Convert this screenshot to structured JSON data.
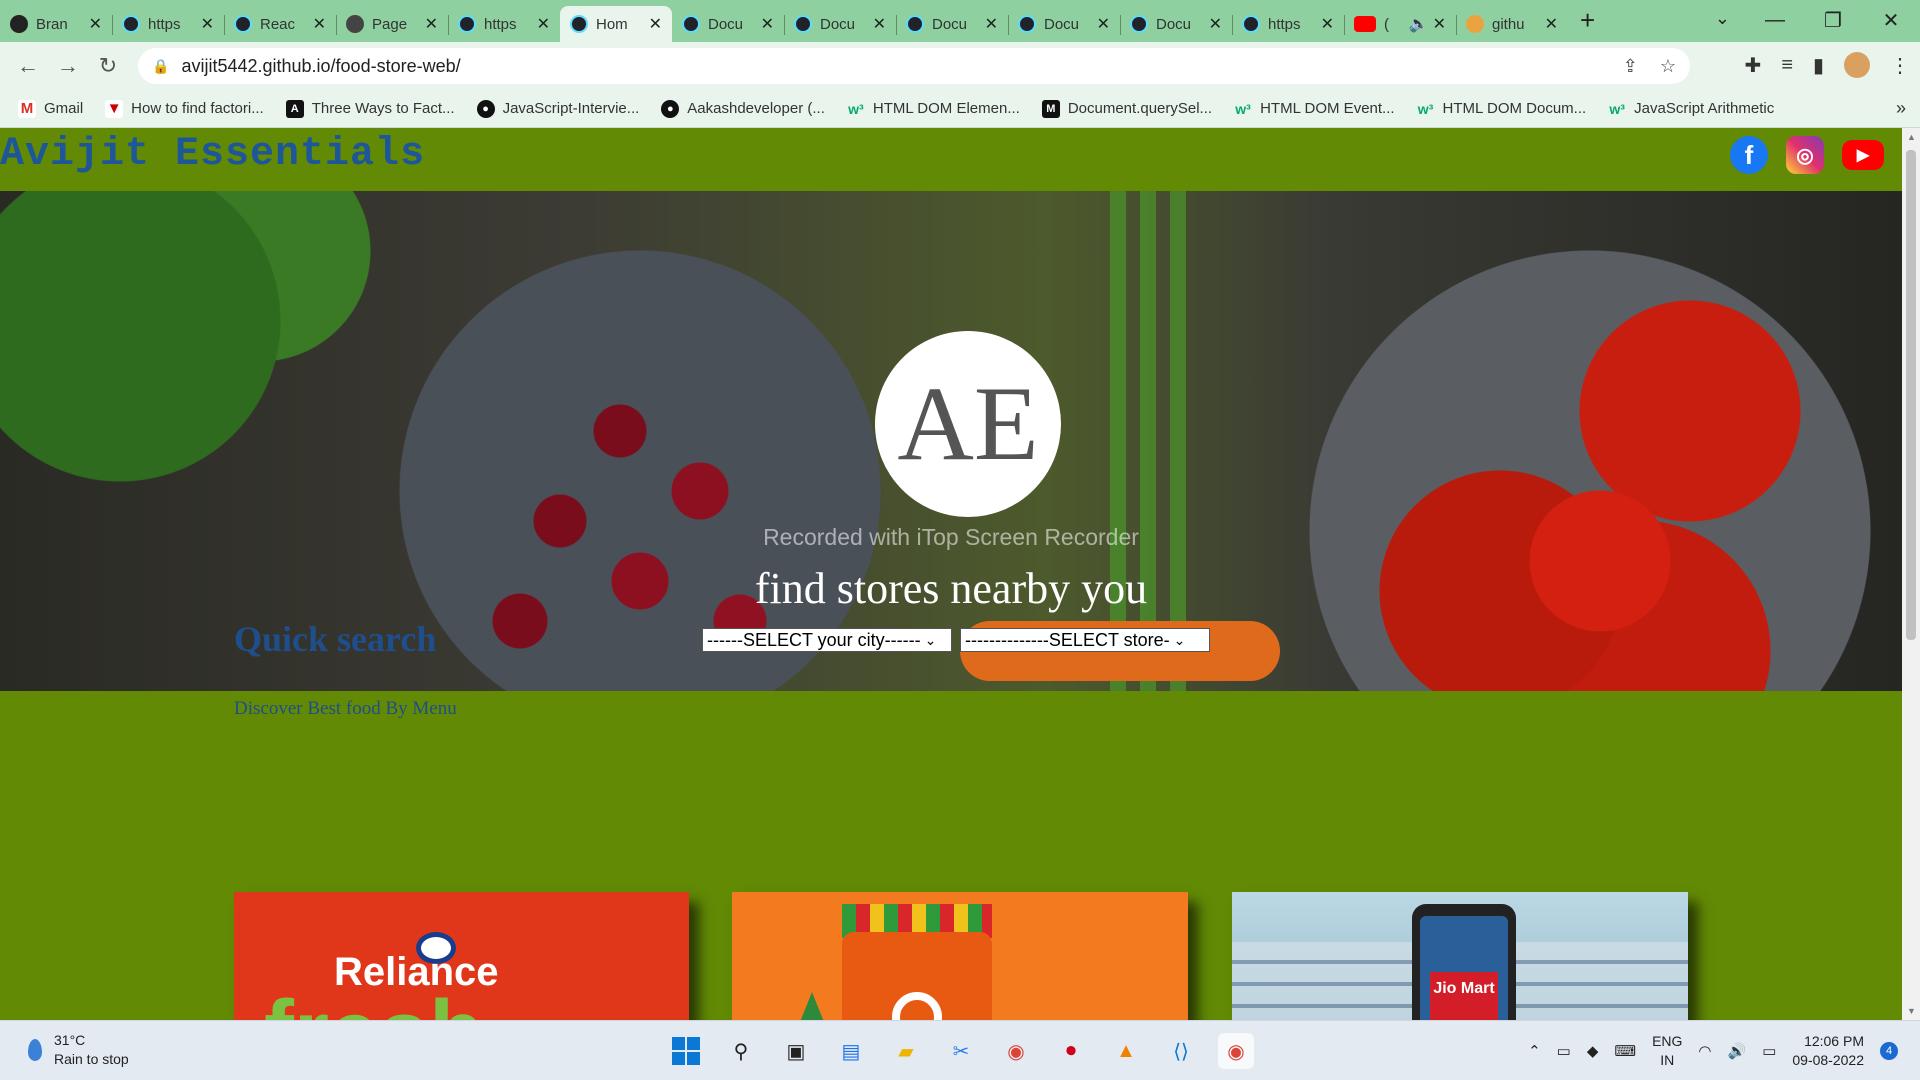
{
  "browser": {
    "tabs": [
      {
        "label": "Bran",
        "favicon": "github-icon"
      },
      {
        "label": "https",
        "favicon": "react-icon"
      },
      {
        "label": "Reac",
        "favicon": "react-icon"
      },
      {
        "label": "Page",
        "favicon": "globe-icon"
      },
      {
        "label": "https",
        "favicon": "react-icon"
      },
      {
        "label": "Hom",
        "favicon": "react-icon",
        "active": true
      },
      {
        "label": "Docu",
        "favicon": "react-icon"
      },
      {
        "label": "Docu",
        "favicon": "react-icon"
      },
      {
        "label": "Docu",
        "favicon": "react-icon"
      },
      {
        "label": "Docu",
        "favicon": "react-icon"
      },
      {
        "label": "Docu",
        "favicon": "react-icon"
      },
      {
        "label": "https",
        "favicon": "react-icon"
      },
      {
        "label": "(",
        "favicon": "youtube-icon"
      },
      {
        "label": "githu",
        "favicon": "github-icon"
      }
    ],
    "url": "avijit5442.github.io/food-store-web/",
    "bookmarks": [
      {
        "label": "Gmail",
        "icon": "gmail-icon"
      },
      {
        "label": "How to find factori...",
        "icon": "youtube-icon"
      },
      {
        "label": "Three Ways to Fact...",
        "icon": "a-icon"
      },
      {
        "label": "JavaScript-Intervie...",
        "icon": "github-icon"
      },
      {
        "label": "Aakashdeveloper (...",
        "icon": "github-icon"
      },
      {
        "label": "HTML DOM Elemen...",
        "icon": "w3schools-icon"
      },
      {
        "label": "Document.querySel...",
        "icon": "mdn-icon"
      },
      {
        "label": "HTML DOM Event...",
        "icon": "w3schools-icon"
      },
      {
        "label": "HTML DOM Docum...",
        "icon": "w3schools-icon"
      },
      {
        "label": "JavaScript Arithmetic",
        "icon": "w3schools-icon"
      }
    ]
  },
  "site": {
    "title": "Avijit Essentials",
    "logo_text": "AE",
    "watermark": "Recorded with iTop Screen Recorder",
    "hero_heading": "find stores nearby you",
    "city_select": "------SELECT your city------",
    "store_select": "--------------SELECT store-",
    "quick_title": "Quick search",
    "quick_sub": "Discover Best food By Menu",
    "cards": [
      {
        "brand_text": "Reliance",
        "brand_text2": "fresh"
      },
      {
        "brand_text": "G"
      },
      {
        "brand_text": "Jio Mart"
      }
    ],
    "colors": {
      "header_bg": "#628a05",
      "title_color": "#1e5799",
      "accent_blue": "#1f4e8c"
    }
  },
  "taskbar": {
    "temperature": "31°C",
    "weather": "Rain to stop",
    "lang1": "ENG",
    "lang2": "IN",
    "time": "12:06 PM",
    "date": "09-08-2022",
    "notifications": "4"
  }
}
